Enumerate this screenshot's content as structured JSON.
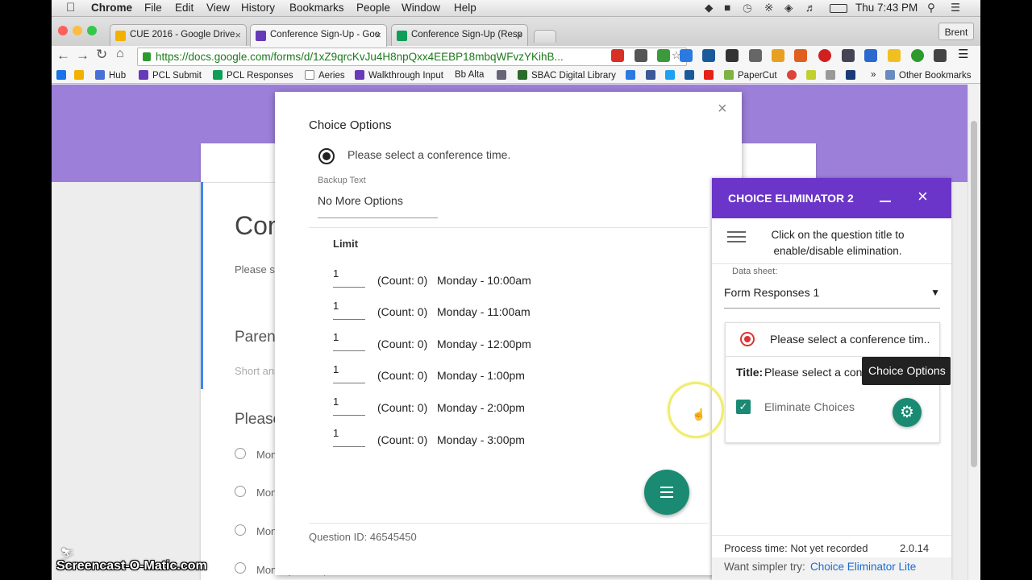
{
  "menubar": {
    "app": "Chrome",
    "items": [
      "File",
      "Edit",
      "View",
      "History",
      "Bookmarks",
      "People",
      "Window",
      "Help"
    ],
    "clock": "Thu 7:43 PM"
  },
  "tabs": [
    {
      "title": "CUE 2016 - Google Drive",
      "color": "#f2b100"
    },
    {
      "title": "Conference Sign-Up - Goo",
      "color": "#673ab7"
    },
    {
      "title": "Conference Sign-Up (Resp",
      "color": "#0f9d58"
    }
  ],
  "profile": "Brent",
  "url": "https://docs.google.com/forms/d/1xZ9qrcKvJu4H8npQxx4EEBP18mbqWFvzYKihB...",
  "bookmarks": [
    {
      "label": "",
      "color": "#1a73e8"
    },
    {
      "label": "Hub",
      "color": "#4a6fd8"
    },
    {
      "label": "PCL Submit",
      "color": "#673ab7"
    },
    {
      "label": "PCL Responses",
      "color": "#0f9d58"
    },
    {
      "label": "Aeries",
      "color": "#777777"
    },
    {
      "label": "Walkthrough Input",
      "color": "#673ab7"
    },
    {
      "label": "Bb Alta",
      "color": "#333333"
    },
    {
      "label": "SBAC Digital Library",
      "color": "#2a6a2a"
    },
    {
      "label": "PaperCut",
      "color": "#7cb342"
    },
    {
      "label": "Other Bookmarks",
      "color": "#6a8bbf"
    }
  ],
  "form_behind": {
    "title_partial": "Con",
    "desc_partial": "Please se",
    "q1_partial": "Paren",
    "short_answer_partial": "Short ans",
    "q2_partial": "Please",
    "option_partial": "Mon",
    "last_option": "Monday - 1:00pm"
  },
  "dialog": {
    "title": "Choice Options",
    "question": "Please select a conference time.",
    "backup_label": "Backup Text",
    "backup_value": "No More Options",
    "limit_header": "Limit",
    "rows": [
      {
        "limit": "1",
        "count": "(Count: 0)",
        "choice": "Monday - 10:00am"
      },
      {
        "limit": "1",
        "count": "(Count: 0)",
        "choice": "Monday - 11:00am"
      },
      {
        "limit": "1",
        "count": "(Count: 0)",
        "choice": "Monday - 12:00pm"
      },
      {
        "limit": "1",
        "count": "(Count: 0)",
        "choice": "Monday - 1:00pm"
      },
      {
        "limit": "1",
        "count": "(Count: 0)",
        "choice": "Monday - 2:00pm"
      },
      {
        "limit": "1",
        "count": "(Count: 0)",
        "choice": "Monday - 3:00pm"
      }
    ],
    "question_id": "Question ID: 46545450"
  },
  "sidebar": {
    "title": "CHOICE ELIMINATOR 2",
    "instructions": "Click on the question title to enable/disable elimination.",
    "datasheet_label": "Data sheet:",
    "datasheet_value": "Form Responses 1",
    "card_question": "Please select a conference tim..",
    "card_title_label": "Title:",
    "card_title_value": "Please select a conf",
    "eliminate_label": "Eliminate Choices",
    "eliminate_checked": true,
    "process_time": "Process time: Not yet recorded",
    "version": "2.0.14",
    "simpler_prefix": "Want simpler try:",
    "simpler_link": "Choice Eliminator Lite",
    "accent": "#6b35c9"
  },
  "tooltip": "Choice Options",
  "watermark": "Screencast-O-Matic.com"
}
